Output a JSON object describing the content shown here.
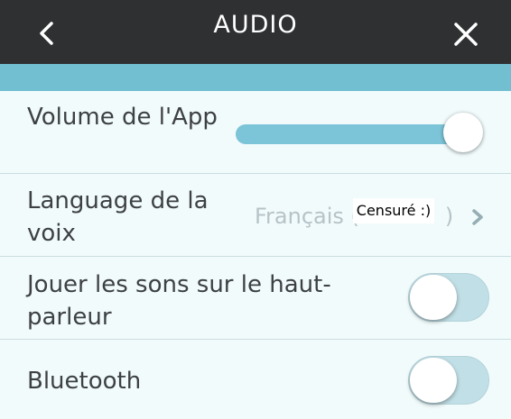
{
  "header": {
    "title": "AUDIO",
    "back_icon": "chevron-left-icon",
    "close_icon": "close-icon",
    "background_color": "#2f3032",
    "accent_color": "#72bfd2"
  },
  "settings": {
    "app_volume": {
      "label": "Volume de l'App",
      "level": 1.0
    },
    "voice_language": {
      "label": "Language de la voix",
      "value": "Français (",
      "value_suffix": ")",
      "redaction_text": "Censuré :)",
      "chevron_icon": "chevron-right-icon"
    },
    "speaker_sounds": {
      "label": "Jouer les sons sur le haut-parleur",
      "enabled": false
    },
    "bluetooth": {
      "label": "Bluetooth",
      "enabled": false
    }
  }
}
